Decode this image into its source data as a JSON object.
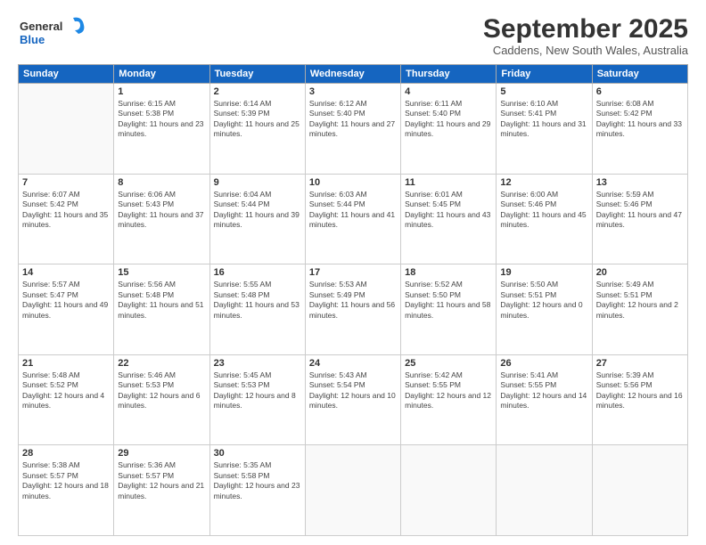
{
  "header": {
    "logo_general": "General",
    "logo_blue": "Blue",
    "month_title": "September 2025",
    "location": "Caddens, New South Wales, Australia"
  },
  "weekdays": [
    "Sunday",
    "Monday",
    "Tuesday",
    "Wednesday",
    "Thursday",
    "Friday",
    "Saturday"
  ],
  "weeks": [
    [
      {
        "day": "",
        "sunrise": "",
        "sunset": "",
        "daylight": ""
      },
      {
        "day": "1",
        "sunrise": "Sunrise: 6:15 AM",
        "sunset": "Sunset: 5:38 PM",
        "daylight": "Daylight: 11 hours and 23 minutes."
      },
      {
        "day": "2",
        "sunrise": "Sunrise: 6:14 AM",
        "sunset": "Sunset: 5:39 PM",
        "daylight": "Daylight: 11 hours and 25 minutes."
      },
      {
        "day": "3",
        "sunrise": "Sunrise: 6:12 AM",
        "sunset": "Sunset: 5:40 PM",
        "daylight": "Daylight: 11 hours and 27 minutes."
      },
      {
        "day": "4",
        "sunrise": "Sunrise: 6:11 AM",
        "sunset": "Sunset: 5:40 PM",
        "daylight": "Daylight: 11 hours and 29 minutes."
      },
      {
        "day": "5",
        "sunrise": "Sunrise: 6:10 AM",
        "sunset": "Sunset: 5:41 PM",
        "daylight": "Daylight: 11 hours and 31 minutes."
      },
      {
        "day": "6",
        "sunrise": "Sunrise: 6:08 AM",
        "sunset": "Sunset: 5:42 PM",
        "daylight": "Daylight: 11 hours and 33 minutes."
      }
    ],
    [
      {
        "day": "7",
        "sunrise": "Sunrise: 6:07 AM",
        "sunset": "Sunset: 5:42 PM",
        "daylight": "Daylight: 11 hours and 35 minutes."
      },
      {
        "day": "8",
        "sunrise": "Sunrise: 6:06 AM",
        "sunset": "Sunset: 5:43 PM",
        "daylight": "Daylight: 11 hours and 37 minutes."
      },
      {
        "day": "9",
        "sunrise": "Sunrise: 6:04 AM",
        "sunset": "Sunset: 5:44 PM",
        "daylight": "Daylight: 11 hours and 39 minutes."
      },
      {
        "day": "10",
        "sunrise": "Sunrise: 6:03 AM",
        "sunset": "Sunset: 5:44 PM",
        "daylight": "Daylight: 11 hours and 41 minutes."
      },
      {
        "day": "11",
        "sunrise": "Sunrise: 6:01 AM",
        "sunset": "Sunset: 5:45 PM",
        "daylight": "Daylight: 11 hours and 43 minutes."
      },
      {
        "day": "12",
        "sunrise": "Sunrise: 6:00 AM",
        "sunset": "Sunset: 5:46 PM",
        "daylight": "Daylight: 11 hours and 45 minutes."
      },
      {
        "day": "13",
        "sunrise": "Sunrise: 5:59 AM",
        "sunset": "Sunset: 5:46 PM",
        "daylight": "Daylight: 11 hours and 47 minutes."
      }
    ],
    [
      {
        "day": "14",
        "sunrise": "Sunrise: 5:57 AM",
        "sunset": "Sunset: 5:47 PM",
        "daylight": "Daylight: 11 hours and 49 minutes."
      },
      {
        "day": "15",
        "sunrise": "Sunrise: 5:56 AM",
        "sunset": "Sunset: 5:48 PM",
        "daylight": "Daylight: 11 hours and 51 minutes."
      },
      {
        "day": "16",
        "sunrise": "Sunrise: 5:55 AM",
        "sunset": "Sunset: 5:48 PM",
        "daylight": "Daylight: 11 hours and 53 minutes."
      },
      {
        "day": "17",
        "sunrise": "Sunrise: 5:53 AM",
        "sunset": "Sunset: 5:49 PM",
        "daylight": "Daylight: 11 hours and 56 minutes."
      },
      {
        "day": "18",
        "sunrise": "Sunrise: 5:52 AM",
        "sunset": "Sunset: 5:50 PM",
        "daylight": "Daylight: 11 hours and 58 minutes."
      },
      {
        "day": "19",
        "sunrise": "Sunrise: 5:50 AM",
        "sunset": "Sunset: 5:51 PM",
        "daylight": "Daylight: 12 hours and 0 minutes."
      },
      {
        "day": "20",
        "sunrise": "Sunrise: 5:49 AM",
        "sunset": "Sunset: 5:51 PM",
        "daylight": "Daylight: 12 hours and 2 minutes."
      }
    ],
    [
      {
        "day": "21",
        "sunrise": "Sunrise: 5:48 AM",
        "sunset": "Sunset: 5:52 PM",
        "daylight": "Daylight: 12 hours and 4 minutes."
      },
      {
        "day": "22",
        "sunrise": "Sunrise: 5:46 AM",
        "sunset": "Sunset: 5:53 PM",
        "daylight": "Daylight: 12 hours and 6 minutes."
      },
      {
        "day": "23",
        "sunrise": "Sunrise: 5:45 AM",
        "sunset": "Sunset: 5:53 PM",
        "daylight": "Daylight: 12 hours and 8 minutes."
      },
      {
        "day": "24",
        "sunrise": "Sunrise: 5:43 AM",
        "sunset": "Sunset: 5:54 PM",
        "daylight": "Daylight: 12 hours and 10 minutes."
      },
      {
        "day": "25",
        "sunrise": "Sunrise: 5:42 AM",
        "sunset": "Sunset: 5:55 PM",
        "daylight": "Daylight: 12 hours and 12 minutes."
      },
      {
        "day": "26",
        "sunrise": "Sunrise: 5:41 AM",
        "sunset": "Sunset: 5:55 PM",
        "daylight": "Daylight: 12 hours and 14 minutes."
      },
      {
        "day": "27",
        "sunrise": "Sunrise: 5:39 AM",
        "sunset": "Sunset: 5:56 PM",
        "daylight": "Daylight: 12 hours and 16 minutes."
      }
    ],
    [
      {
        "day": "28",
        "sunrise": "Sunrise: 5:38 AM",
        "sunset": "Sunset: 5:57 PM",
        "daylight": "Daylight: 12 hours and 18 minutes."
      },
      {
        "day": "29",
        "sunrise": "Sunrise: 5:36 AM",
        "sunset": "Sunset: 5:57 PM",
        "daylight": "Daylight: 12 hours and 21 minutes."
      },
      {
        "day": "30",
        "sunrise": "Sunrise: 5:35 AM",
        "sunset": "Sunset: 5:58 PM",
        "daylight": "Daylight: 12 hours and 23 minutes."
      },
      {
        "day": "",
        "sunrise": "",
        "sunset": "",
        "daylight": ""
      },
      {
        "day": "",
        "sunrise": "",
        "sunset": "",
        "daylight": ""
      },
      {
        "day": "",
        "sunrise": "",
        "sunset": "",
        "daylight": ""
      },
      {
        "day": "",
        "sunrise": "",
        "sunset": "",
        "daylight": ""
      }
    ]
  ]
}
